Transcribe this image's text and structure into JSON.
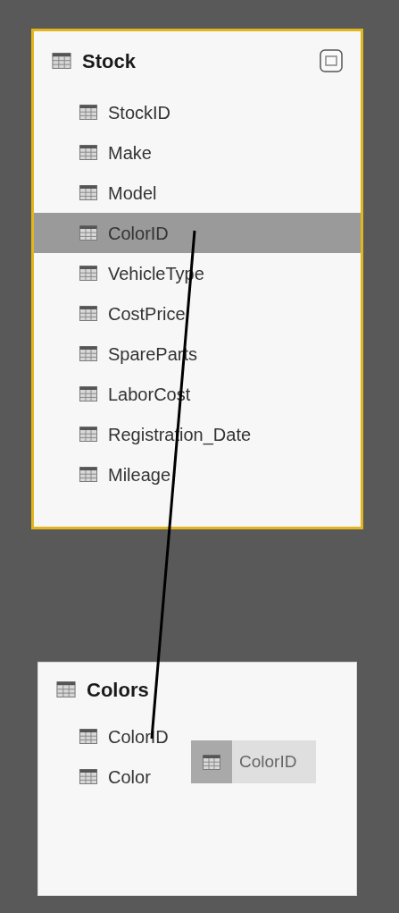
{
  "tables": [
    {
      "title": "Stock",
      "highlighted": true,
      "fields": [
        {
          "label": "StockID",
          "selected": false
        },
        {
          "label": "Make",
          "selected": false
        },
        {
          "label": "Model",
          "selected": false
        },
        {
          "label": "ColorID",
          "selected": true
        },
        {
          "label": "VehicleType",
          "selected": false
        },
        {
          "label": "CostPrice",
          "selected": false
        },
        {
          "label": "SpareParts",
          "selected": false
        },
        {
          "label": "LaborCost",
          "selected": false
        },
        {
          "label": "Registration_Date",
          "selected": false
        },
        {
          "label": "Mileage",
          "selected": false
        }
      ]
    },
    {
      "title": "Colors",
      "highlighted": false,
      "fields": [
        {
          "label": "ColorID",
          "selected": false
        },
        {
          "label": "Color",
          "selected": false
        }
      ]
    }
  ],
  "drag_ghost": {
    "label": "ColorID"
  }
}
